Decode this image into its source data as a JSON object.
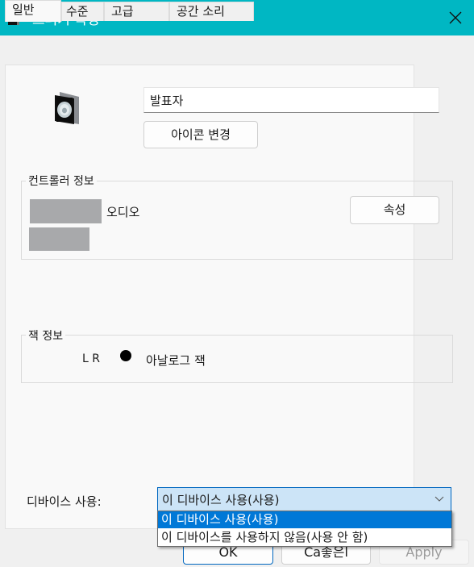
{
  "window": {
    "title": "스피커 속성",
    "accent_color": "#00b7c3",
    "icon": "speaker-icon",
    "close_icon": "close-icon"
  },
  "tabs": [
    {
      "label": "일반",
      "active": true
    },
    {
      "label": "수준",
      "active": false
    },
    {
      "label": "고급",
      "active": false
    },
    {
      "label": "공간 소리",
      "active": false
    }
  ],
  "general": {
    "device_name_value": "발표자",
    "change_icon_label": "아이콘 변경",
    "controller_group": {
      "title": "컨트롤러 정보",
      "line1_suffix": "오디오",
      "properties_label": "속성"
    },
    "jack_group": {
      "title": "잭 정보",
      "channels": "L R",
      "jack_type": "아날로그 잭"
    },
    "device_usage": {
      "label": "디바이스 사용:",
      "selected": "이 디바이스 사용(사용)",
      "options": [
        "이 디바이스 사용(사용)",
        "이 디바이스를 사용하지 않음(사용 안 함)"
      ]
    }
  },
  "footer": {
    "ok_label": "OK",
    "cancel_label": "Ca좋은l",
    "apply_label": "Apply"
  }
}
